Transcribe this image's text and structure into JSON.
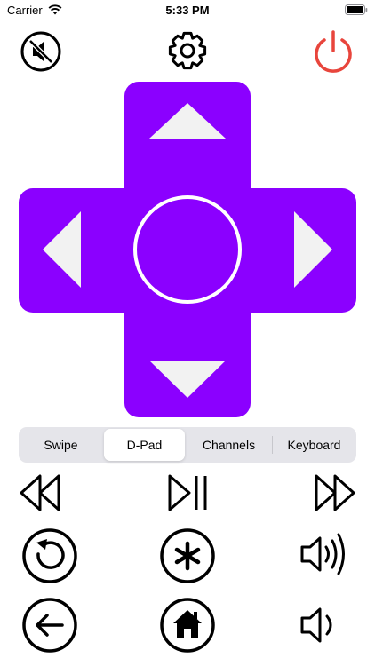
{
  "status_bar": {
    "carrier": "Carrier",
    "time": "5:33 PM"
  },
  "colors": {
    "accent": "#8b00ff",
    "power": "#e8453c",
    "arrow": "#f2f2f2"
  },
  "top_controls": {
    "left": {
      "icon": "mute-icon"
    },
    "center": {
      "icon": "gear-icon"
    },
    "right": {
      "icon": "power-icon"
    }
  },
  "dpad": {
    "up": {
      "icon": "arrow-up-icon"
    },
    "left": {
      "icon": "arrow-left-icon"
    },
    "right": {
      "icon": "arrow-right-icon"
    },
    "down": {
      "icon": "arrow-down-icon"
    },
    "ok": {
      "icon": "ok-circle-icon"
    }
  },
  "mode_tabs": {
    "items": [
      "Swipe",
      "D-Pad",
      "Channels",
      "Keyboard"
    ],
    "selected": "D-Pad"
  },
  "media_controls": {
    "row1": [
      "rewind-icon",
      "play-pause-icon",
      "fast-forward-icon"
    ],
    "row2": [
      "replay-icon",
      "options-asterisk-icon",
      "volume-up-icon"
    ],
    "row3": [
      "back-icon",
      "home-icon",
      "volume-down-icon"
    ]
  }
}
